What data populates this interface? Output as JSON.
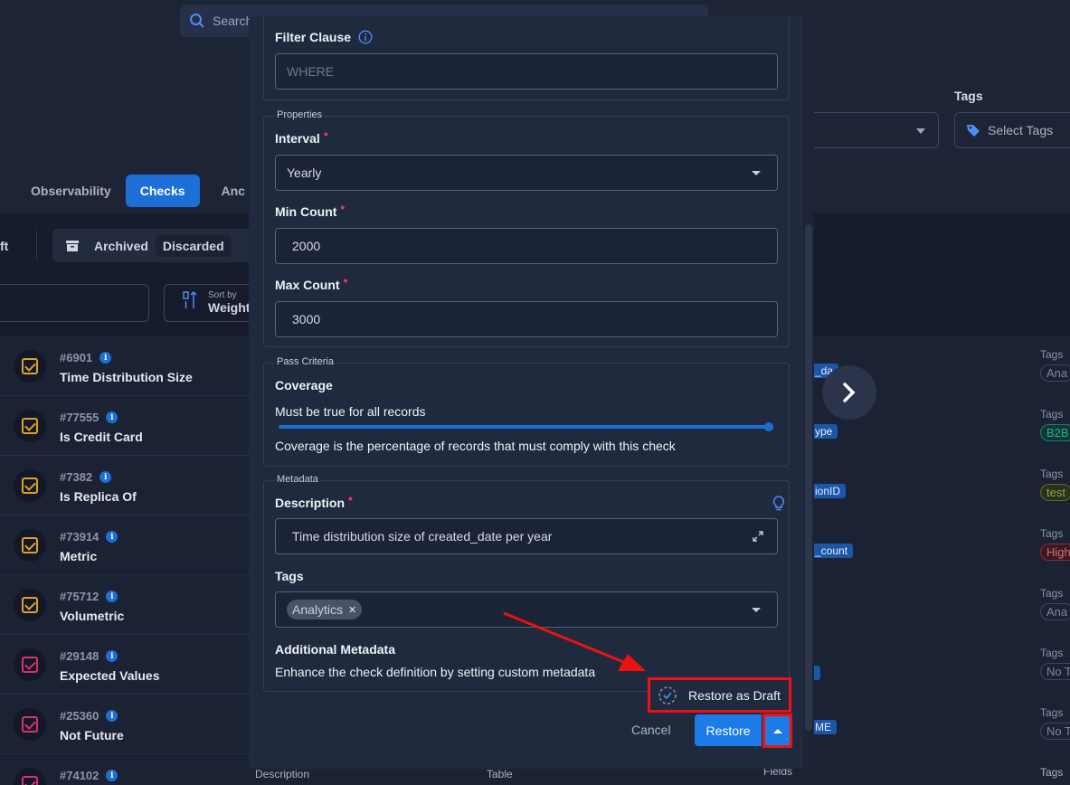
{
  "background": {
    "search_placeholder": "Search",
    "tags_label": "Tags",
    "tags_select_placeholder": "Select Tags",
    "tabs": [
      {
        "label": "Observability"
      },
      {
        "label": "Checks"
      },
      {
        "label": "Anc"
      }
    ],
    "ft_text": "ft",
    "filters": {
      "archived": "Archived",
      "discarded": "Discarded"
    },
    "sort": {
      "caption": "Sort by",
      "value": "Weight"
    },
    "checks": [
      {
        "id": "#6901",
        "name": "Time Distribution Size",
        "status_color": "#e0a124"
      },
      {
        "id": "#77555",
        "name": "Is Credit Card",
        "status_color": "#e0a124"
      },
      {
        "id": "#7382",
        "name": "Is Replica Of",
        "status_color": "#e0a124"
      },
      {
        "id": "#73914",
        "name": "Metric",
        "status_color": "#e0a124"
      },
      {
        "id": "#75712",
        "name": "Volumetric",
        "status_color": "#e0a124"
      },
      {
        "id": "#29148",
        "name": "Expected Values",
        "status_color": "#d6336c"
      },
      {
        "id": "#25360",
        "name": "Not Future",
        "status_color": "#d6336c"
      },
      {
        "id": "#74102",
        "name": "",
        "status_color": "#d6336c"
      }
    ],
    "right_rows": [
      {
        "field": "_da",
        "tags_label": "Tags",
        "tag": "Ana"
      },
      {
        "field": "ype",
        "tags_label": "Tags",
        "tag": "B2B"
      },
      {
        "field": "ionID",
        "tags_label": "Tags",
        "tag": "test"
      },
      {
        "field": "_count",
        "tags_label": "Tags",
        "tag": "High"
      },
      {
        "field": "",
        "tags_label": "Tags",
        "tag": "Ana"
      },
      {
        "field": "",
        "tags_label": "Tags",
        "tag": "No T"
      },
      {
        "field": "ME",
        "tags_label": "Tags",
        "tag": "No T"
      }
    ],
    "bottom_labels": {
      "description": "Description",
      "table": "Table",
      "fields": "Fields",
      "tags": "Tags"
    }
  },
  "modal": {
    "filter_clause": {
      "label": "Filter Clause",
      "placeholder": "WHERE"
    },
    "properties": {
      "legend": "Properties",
      "interval": {
        "label": "Interval",
        "value": "Yearly"
      },
      "min_count": {
        "label": "Min Count",
        "value": "2000"
      },
      "max_count": {
        "label": "Max Count",
        "value": "3000"
      }
    },
    "pass_criteria": {
      "legend": "Pass Criteria",
      "coverage_label": "Coverage",
      "coverage_text": "Must be true for all records",
      "coverage_value": 1.0,
      "coverage_help": "Coverage is the percentage of records that must comply with this check"
    },
    "metadata": {
      "legend": "Metadata",
      "description": {
        "label": "Description",
        "value": "Time distribution size of created_date per year"
      },
      "tags": {
        "label": "Tags",
        "chips": [
          "Analytics"
        ]
      },
      "additional": {
        "label": "Additional Metadata",
        "text": "Enhance the check definition by setting custom metadata"
      }
    },
    "actions": {
      "restore_as_draft": "Restore as Draft",
      "cancel": "Cancel",
      "restore": "Restore"
    }
  },
  "colors": {
    "accent": "#1c7be6",
    "required": "#e8336b",
    "highlight": "#ee1111"
  }
}
